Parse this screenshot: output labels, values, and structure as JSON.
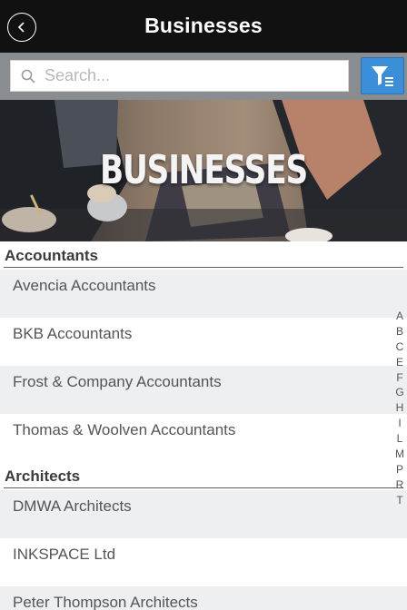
{
  "header": {
    "title": "Businesses",
    "back_icon": "chevron-left-icon"
  },
  "search": {
    "placeholder": "Search...",
    "value": "",
    "filter_icon": "filter-list-icon",
    "filter_color": "#3a8fd8"
  },
  "banner": {
    "title": "BUSINESSES"
  },
  "sections": [
    {
      "title": "Accountants",
      "items": [
        "Avencia Accountants",
        "BKB Accountants",
        "Frost & Company Accountants",
        "Thomas & Woolven Accountants"
      ]
    },
    {
      "title": "Architects",
      "items": [
        "DMWA Architects",
        "INKSPACE Ltd",
        "Peter Thompson Architects"
      ]
    }
  ],
  "alpha_index": [
    "A",
    "B",
    "C",
    "E",
    "F",
    "G",
    "H",
    "I",
    "L",
    "M",
    "P",
    "R",
    "T"
  ]
}
